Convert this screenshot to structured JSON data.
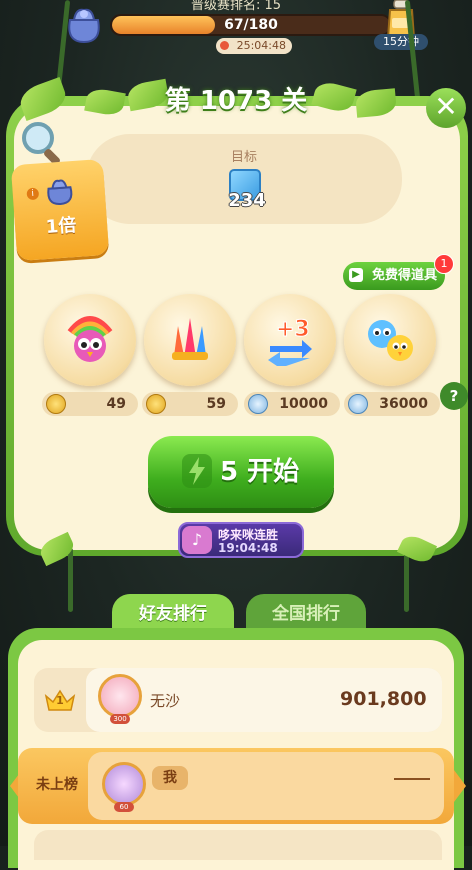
{
  "top": {
    "rank_text": "晋级赛排名: 15",
    "progress_text": "67/180",
    "progress_fraction": 0.372,
    "timer": "25:04:48",
    "bottle_label": "15分钟"
  },
  "level": {
    "title": "第 1073 关",
    "close_label": "✕"
  },
  "goal": {
    "label": "目标",
    "count": "234"
  },
  "multiplier": {
    "info": "i",
    "label": "1倍"
  },
  "free_item": {
    "label": "免费得道具",
    "badge": "1"
  },
  "boosters": [
    {
      "icon": "rainbow-bird-icon",
      "price": "49",
      "currency": "gold-coin-icon"
    },
    {
      "icon": "rocket-bundle-icon",
      "price": "59",
      "currency": "gold-coin-icon"
    },
    {
      "icon": "plus-three-moves-icon",
      "price": "10000",
      "currency": "silver-coin-icon"
    },
    {
      "icon": "bird-pair-icon",
      "price": "36000",
      "currency": "silver-coin-icon"
    }
  ],
  "help_label": "?",
  "start": {
    "energy": "5",
    "label": "开始"
  },
  "streak": {
    "name": "哆来咪连胜",
    "time": "19:04:48"
  },
  "ranking": {
    "tabs": [
      "好友排行",
      "全国排行"
    ],
    "active_tab": 0,
    "rows": [
      {
        "rank": "1",
        "name": "无沙",
        "score": "901,800",
        "level_badge": "300"
      }
    ],
    "me": {
      "status": "未上榜",
      "tag": "我",
      "score": "",
      "level_badge": "60"
    }
  },
  "colors": {
    "frame_green": "#6fb92e",
    "panel_cream": "#fcf4d8",
    "start_green": "#3fae1e",
    "progress_orange": "#f0963a"
  }
}
